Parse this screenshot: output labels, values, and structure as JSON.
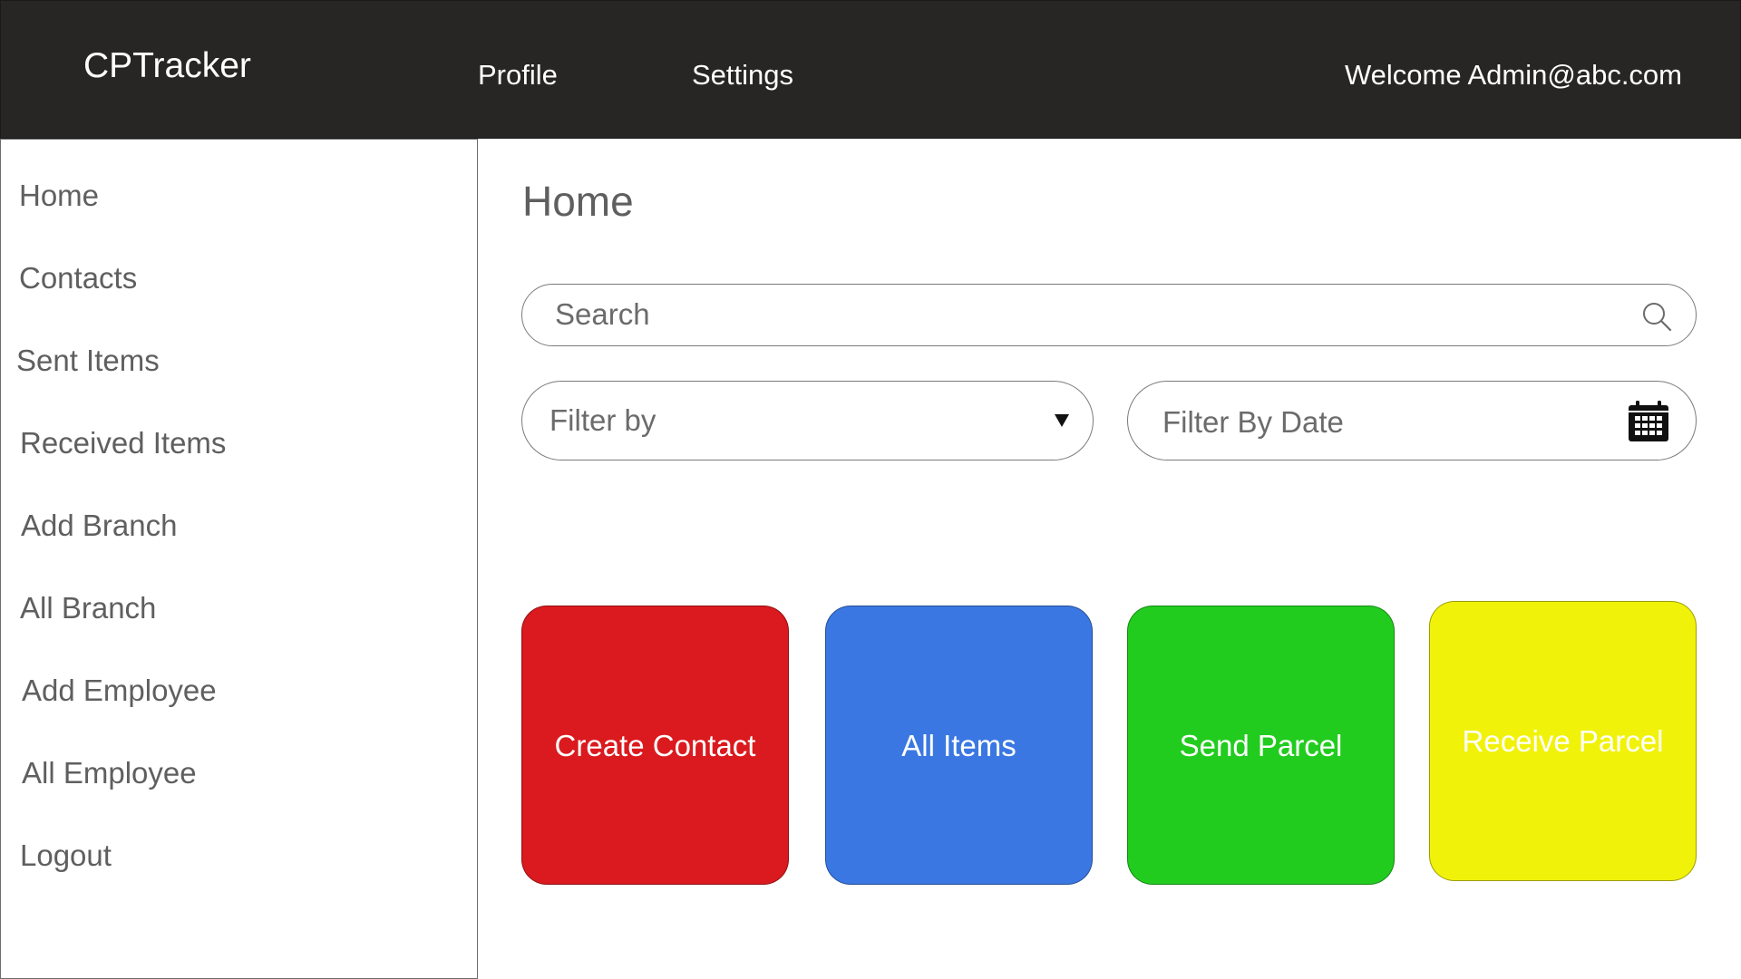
{
  "app": {
    "brand": "CPTracker"
  },
  "topnav": {
    "profile_label": "Profile",
    "settings_label": "Settings",
    "welcome_text": "Welcome Admin@abc.com"
  },
  "sidebar": {
    "items": [
      {
        "label": "Home"
      },
      {
        "label": "Contacts"
      },
      {
        "label": "Sent Items"
      },
      {
        "label": "Received Items"
      },
      {
        "label": "Add Branch"
      },
      {
        "label": "All Branch"
      },
      {
        "label": "Add Employee"
      },
      {
        "label": "All Employee"
      },
      {
        "label": "Logout"
      }
    ]
  },
  "main": {
    "title": "Home",
    "search": {
      "placeholder": "Search",
      "value": "",
      "icon": "search-icon"
    },
    "filter_by": {
      "label": "Filter by",
      "icon": "caret-down-icon"
    },
    "filter_date": {
      "label": "Filter By Date",
      "icon": "calendar-icon"
    },
    "tiles": [
      {
        "label": "Create Contact",
        "color": "#DA1A1E",
        "text_color": "#FFFFFF"
      },
      {
        "label": "All Items",
        "color": "#3A77E2",
        "text_color": "#FFFFFF"
      },
      {
        "label": "Send Parcel",
        "color": "#22CC1F",
        "text_color": "#FFFFFF"
      },
      {
        "label": "Receive Parcel",
        "color": "#F1F20A",
        "text_color": "#FFFFFF"
      }
    ]
  },
  "colors": {
    "topbar_bg": "#282624",
    "sidebar_text": "#5F5F5F",
    "border": "#7B7B7B"
  }
}
